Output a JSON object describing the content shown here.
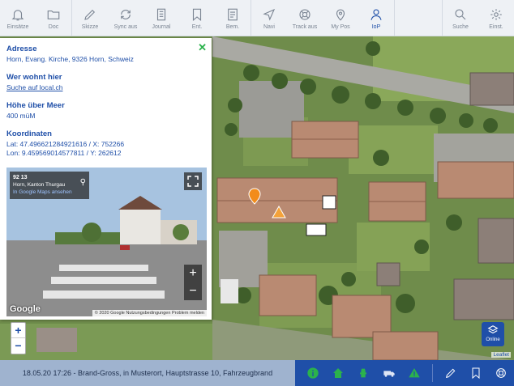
{
  "toolbar": {
    "items": [
      {
        "label": "Einsätze",
        "icon": "bell-icon"
      },
      {
        "label": "Doc",
        "icon": "folder-icon"
      },
      {
        "label": "Skizze",
        "icon": "pencil-icon"
      },
      {
        "label": "Sync aus",
        "icon": "sync-icon"
      },
      {
        "label": "Journal",
        "icon": "journal-icon"
      },
      {
        "label": "Ent.",
        "icon": "bookmark-icon"
      },
      {
        "label": "Bem.",
        "icon": "note-icon"
      },
      {
        "label": "Navi",
        "icon": "navigation-icon"
      },
      {
        "label": "Track aus",
        "icon": "lifebuoy-icon"
      },
      {
        "label": "My Pos",
        "icon": "location-pin-icon"
      },
      {
        "label": "IoP",
        "icon": "person-icon"
      },
      {
        "label": "Suche",
        "icon": "search-icon"
      },
      {
        "label": "Einst.",
        "icon": "gear-icon"
      }
    ],
    "active": "IoP"
  },
  "panel": {
    "close": "✕",
    "address_title": "Adresse",
    "address_text": "Horn, Evang. Kirche, 9326 Horn, Schweiz",
    "residents_title": "Wer wohnt hier",
    "residents_link": "Suche auf local.ch",
    "altitude_title": "Höhe über Meer",
    "altitude_text": "400 müM",
    "coords_title": "Koordinaten",
    "coords_lat": "Lat: 47.496621284921616 / X: 752266",
    "coords_lon": "Lon: 9.459569014577811 / Y: 262612",
    "streetview": {
      "card_title": "92 13",
      "card_sub": "Horn, Kanton Thurgau",
      "card_link": "In Google Maps ansehen",
      "zoom_in": "+",
      "zoom_out": "−",
      "logo": "Google",
      "credits": "© 2020 Google   Nutzungsbedingungen   Problem melden"
    }
  },
  "map": {
    "zoom_in": "+",
    "zoom_out": "−",
    "layer_label": "Online",
    "attribution": "Leaflet"
  },
  "status": {
    "text": "18.05.20 17:26 - Brand-Gross, in Musterort, Hauptstrasse 10, Fahrzeugbrand"
  },
  "actions": [
    {
      "icon": "info-icon"
    },
    {
      "icon": "home-icon"
    },
    {
      "icon": "hydrant-icon"
    },
    {
      "icon": "truck-icon"
    },
    {
      "icon": "warning-icon"
    },
    {
      "icon": "pencil-icon"
    },
    {
      "icon": "bookmark-icon"
    },
    {
      "icon": "lifebuoy-icon"
    }
  ],
  "colors": {
    "brand": "#1f4fa8",
    "accent_green": "#2bb24c",
    "toolbar_bg": "#eef1f5",
    "status_bg": "#9fb3cf"
  }
}
